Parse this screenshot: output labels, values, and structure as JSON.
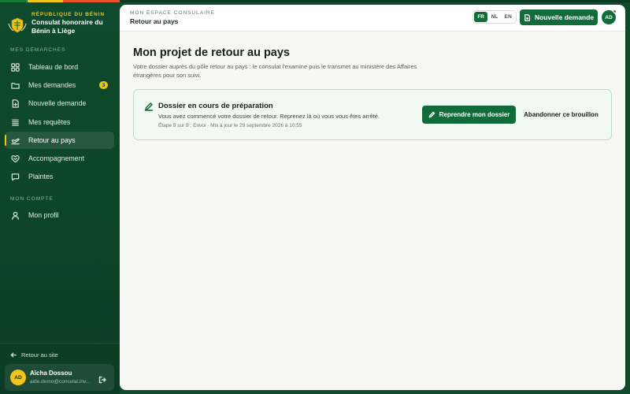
{
  "brand": {
    "kicker": "République du Bénin",
    "name": "Consulat honoraire du Bénin à Liège",
    "seal_icon": "benin-coat-of-arms"
  },
  "sidebar": {
    "section_demarches": "Mes démarches",
    "items": [
      {
        "label": "Tableau de bord",
        "icon": "grid-icon"
      },
      {
        "label": "Mes demandes",
        "icon": "folder-icon",
        "badge": "3"
      },
      {
        "label": "Nouvelle demande",
        "icon": "file-plus-icon"
      },
      {
        "label": "Mes requêtes",
        "icon": "list-icon"
      },
      {
        "label": "Retour au pays",
        "icon": "plane-icon",
        "active": true
      },
      {
        "label": "Accompagnement",
        "icon": "handshake-icon"
      },
      {
        "label": "Plaintes",
        "icon": "message-icon"
      }
    ],
    "section_compte": "Mon compte",
    "account_items": [
      {
        "label": "Mon profil",
        "icon": "user-icon"
      }
    ],
    "back_to_site": "Retour au site",
    "user": {
      "initials": "AD",
      "name": "Aïcha Dossou",
      "email": "aide.demo@consulat.inv..."
    }
  },
  "header": {
    "kicker": "Mon espace consulaire",
    "crumb": "Retour au pays",
    "languages": [
      "FR",
      "NL",
      "EN"
    ],
    "active_language": "FR",
    "new_request_label": "Nouvelle demande",
    "avatar_initials": "AD"
  },
  "main": {
    "title": "Mon projet de retour au pays",
    "description": "Votre dossier auprès du pôle retour au pays : le consulat l'examine puis le transmet au ministère des Affaires étrangères pour son suivi.",
    "draft": {
      "title": "Dossier en cours de préparation",
      "text": "Vous avez commencé votre dossier de retour. Reprenez là où vous vous êtes arrêté.",
      "meta": "Étape 5 sur 5 : Envoi · Mis à jour le 29 septembre 2026 à 10:55",
      "resume_label": "Reprendre mon dossier",
      "abandon_label": "Abandonner ce brouillon"
    }
  },
  "colors": {
    "sidebar": "#0f4a2c",
    "primary": "#116b3b",
    "accent": "#f0c419",
    "notification": "#e0463a"
  }
}
